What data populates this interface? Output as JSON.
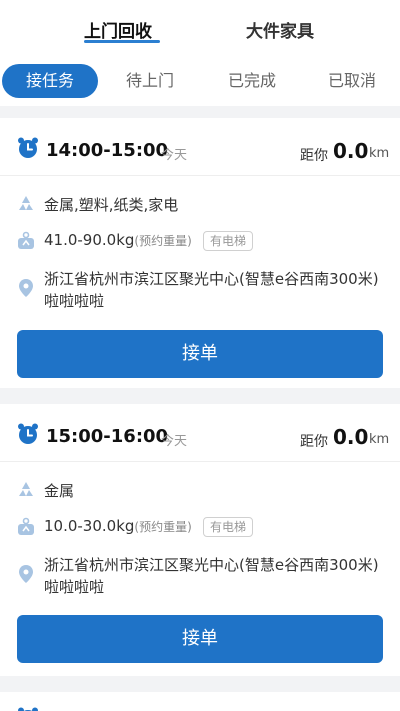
{
  "top_tabs": [
    {
      "label": "上门回收",
      "active": true
    },
    {
      "label": "大件家具",
      "active": false
    }
  ],
  "status_tabs": [
    {
      "label": "接任务",
      "active": true
    },
    {
      "label": "待上门",
      "active": false
    },
    {
      "label": "已完成",
      "active": false
    },
    {
      "label": "已取消",
      "active": false
    }
  ],
  "orders": [
    {
      "time": "14:00-15:00",
      "day": "今天",
      "distance_label": "距你",
      "distance": "0.0",
      "distance_unit": "km",
      "categories": "金属,塑料,纸类,家电",
      "weight": "41.0-90.0kg",
      "weight_note": "(预约重量)",
      "elevator": "有电梯",
      "address": "浙江省杭州市滨江区聚光中心(智慧e谷西南300米)啦啦啦啦",
      "button_label": "接单"
    },
    {
      "time": "15:00-16:00",
      "day": "今天",
      "distance_label": "距你",
      "distance": "0.0",
      "distance_unit": "km",
      "categories": "金属",
      "weight": "10.0-30.0kg",
      "weight_note": "(预约重量)",
      "elevator": "有电梯",
      "address": "浙江省杭州市滨江区聚光中心(智慧e谷西南300米)啦啦啦啦",
      "button_label": "接单"
    }
  ],
  "colors": {
    "accent": "#1f73c7",
    "icon_light": "#a8c4e2"
  },
  "icons": [
    "alarm-clock-icon",
    "recycle-icon",
    "weight-scale-icon",
    "location-pin-icon"
  ]
}
